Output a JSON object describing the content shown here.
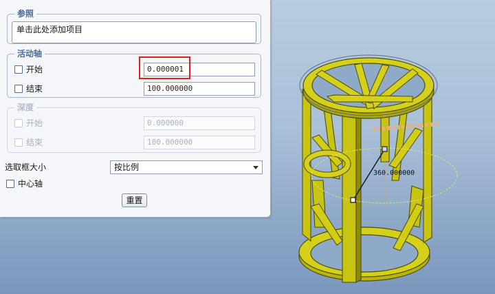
{
  "reference": {
    "title": "参照",
    "placeholder": "单击此处添加项目"
  },
  "active_axis": {
    "title": "活动轴",
    "start": {
      "label": "开始",
      "value": "0.000001",
      "checked": false
    },
    "end": {
      "label": "结束",
      "value": "100.000000",
      "checked": false
    }
  },
  "depth": {
    "title": "深度",
    "start": {
      "label": "开始",
      "value": "0.000000"
    },
    "end": {
      "label": "结束",
      "value": "100.000000"
    }
  },
  "selection_box": {
    "label": "选取框大小",
    "selected": "按比例"
  },
  "center_axis": {
    "label": "中心轴",
    "checked": false
  },
  "reset_label": "重置",
  "viewport": {
    "angle_dimension": "360.000000",
    "model_color": "#c8c414",
    "model_edge_color": "#5f5c08"
  }
}
